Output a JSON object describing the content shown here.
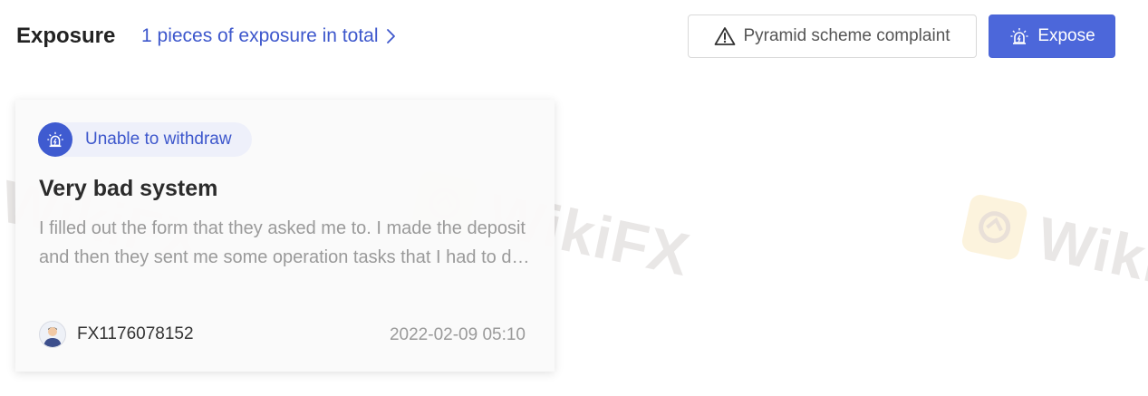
{
  "header": {
    "title": "Exposure",
    "total_link": "1 pieces of exposure in total",
    "complaint_button": "Pyramid scheme complaint",
    "expose_button": "Expose"
  },
  "card": {
    "tag": "Unable to withdraw",
    "title": "Very bad system",
    "body": "I filled out the form that they asked me to. I made the deposit and then they sent me some operation tasks that I had to do. I followed the instructions and I could not withdraw my money.",
    "author": "FX1176078152",
    "timestamp": "2022-02-09 05:10"
  },
  "watermark": {
    "text": "WikiFX"
  },
  "icons": {
    "total_link": "chevron-right-icon",
    "complaint": "warning-triangle-icon",
    "expose": "alarm-siren-icon",
    "tag": "alarm-siren-icon",
    "avatar": "user-avatar-icon"
  },
  "colors": {
    "accent": "#4c67da",
    "link": "#3d57cc",
    "tag_bg": "#eef0fa",
    "watermark_logo": "#f2c14b"
  }
}
